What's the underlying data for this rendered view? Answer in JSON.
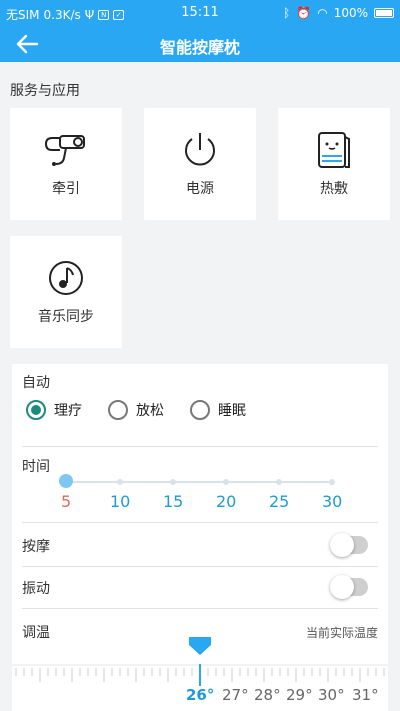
{
  "status_bar": {
    "carrier": "无SIM",
    "speed": "0.3K/s",
    "time": "15:11",
    "battery": "100%"
  },
  "app_bar": {
    "title": "智能按摩枕"
  },
  "services": {
    "title": "服务与应用",
    "items": [
      {
        "label": "牵引",
        "icon": "traction-device-icon"
      },
      {
        "label": "电源",
        "icon": "power-icon"
      },
      {
        "label": "热敷",
        "icon": "hot-compress-icon"
      },
      {
        "label": "音乐同步",
        "icon": "music-note-icon"
      }
    ]
  },
  "auto": {
    "label": "自动",
    "options": [
      "理疗",
      "放松",
      "睡眠"
    ],
    "selected": "理疗"
  },
  "time": {
    "label": "时间",
    "ticks": [
      "5",
      "10",
      "15",
      "20",
      "25",
      "30"
    ],
    "value": 5
  },
  "massage": {
    "label": "按摩",
    "on": false
  },
  "vibration": {
    "label": "振动",
    "on": false
  },
  "temperature": {
    "label": "调温",
    "note": "当前实际温度",
    "ticks": [
      "26°",
      "27°",
      "28°",
      "29°",
      "30°",
      "31°"
    ],
    "selected": "26°"
  },
  "colors": {
    "primary": "#2aa7f3",
    "radio_selected": "#1e8a7d",
    "tick_text": "#1e9bd7",
    "active_tick": "#e06b5a"
  }
}
